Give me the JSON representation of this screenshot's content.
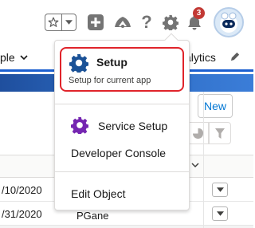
{
  "header": {
    "favorites_icon": "star-icon",
    "favorites_dropdown_icon": "caret-down-icon",
    "global_actions_icon": "plus-square-icon",
    "trailhead_icon": "trailhead-icon",
    "help_icon": "question-icon",
    "help_label": "?",
    "setup_icon": "gear-icon",
    "notifications_icon": "bell-icon",
    "notification_count": "3",
    "avatar_icon": "astro-avatar-icon"
  },
  "nav": {
    "left_label": "ple",
    "right_label": "alytics",
    "edit_icon": "pencil-icon"
  },
  "list": {
    "new_button": "New",
    "rows": [
      {
        "date": "/10/2020",
        "owner": ""
      },
      {
        "date": "/31/2020",
        "owner": "PGane"
      }
    ]
  },
  "setup_menu": {
    "setup_title": "Setup",
    "setup_subtitle": "Setup for current app",
    "service_setup": "Service Setup",
    "developer_console": "Developer Console",
    "edit_object": "Edit Object"
  },
  "colors": {
    "setup_gear": "#1b5297",
    "service_gear": "#7526b1",
    "highlight_border": "#e0242b",
    "badge": "#c23934",
    "brand_blue": "#0176d3"
  }
}
